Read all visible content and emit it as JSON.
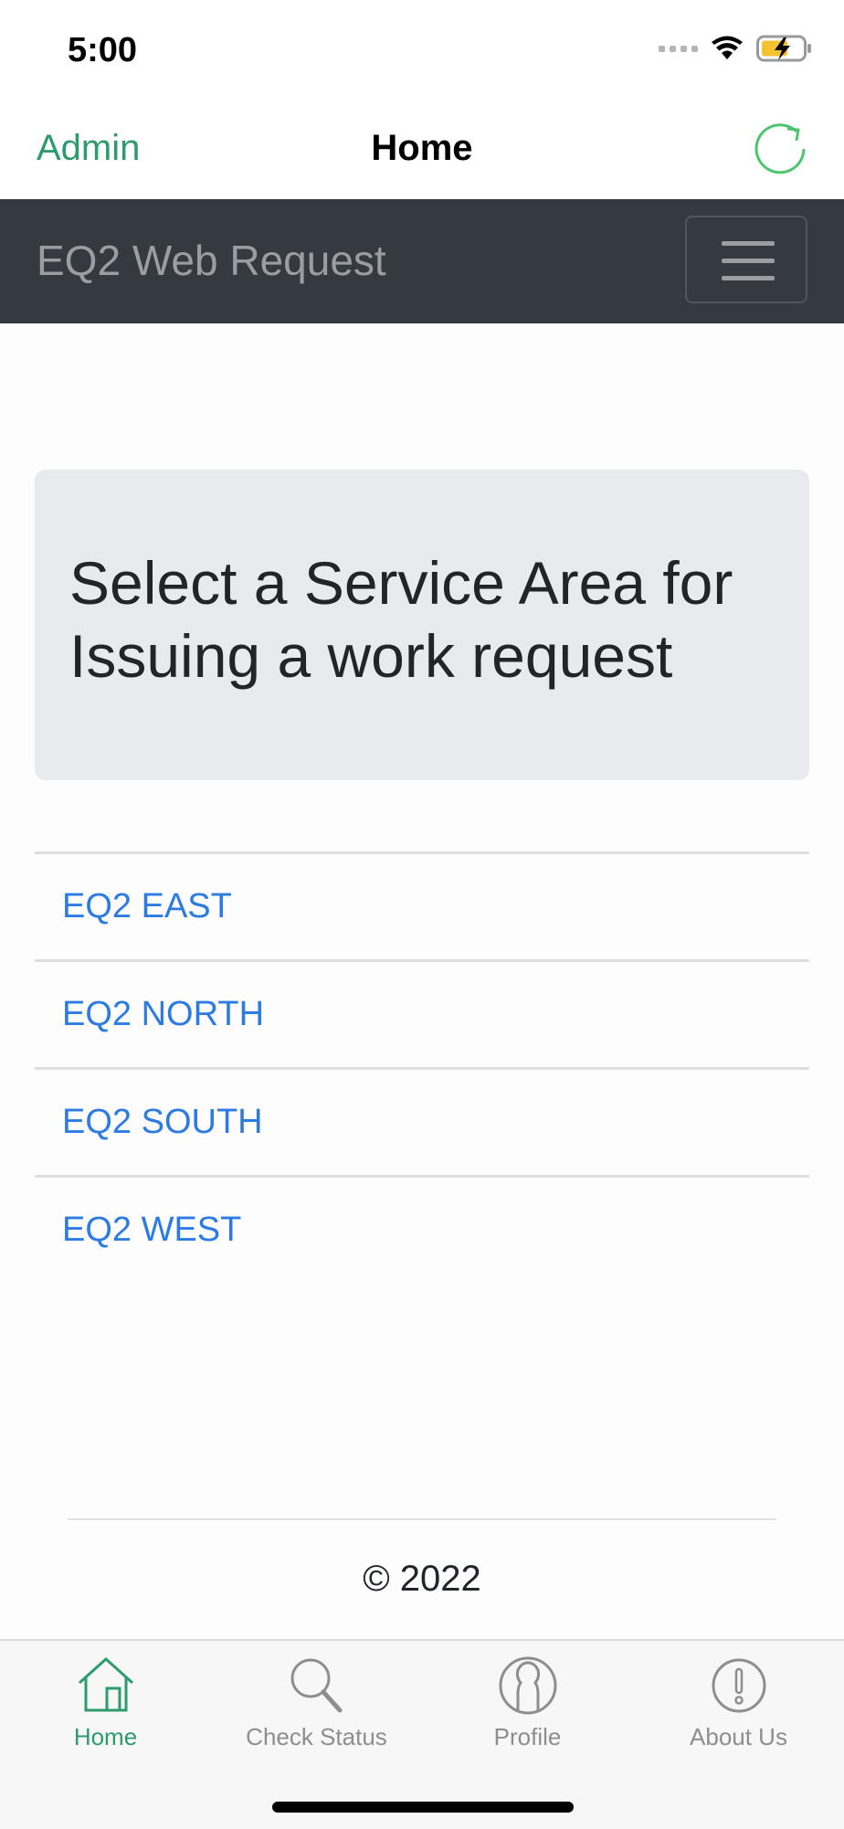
{
  "status_bar": {
    "time": "5:00"
  },
  "nav": {
    "left_label": "Admin",
    "title": "Home"
  },
  "web_navbar": {
    "brand": "EQ2 Web Request"
  },
  "jumbotron": {
    "heading": "Select a Service Area for Issuing a work request"
  },
  "service_areas": [
    "EQ2 EAST",
    "EQ2 NORTH",
    "EQ2 SOUTH",
    "EQ2 WEST"
  ],
  "footer": {
    "text": "© 2022"
  },
  "tabs": [
    {
      "label": "Home",
      "icon": "home-icon",
      "active": true
    },
    {
      "label": "Check Status",
      "icon": "search-icon",
      "active": false
    },
    {
      "label": "Profile",
      "icon": "profile-icon",
      "active": false
    },
    {
      "label": "About Us",
      "icon": "info-icon",
      "active": false
    }
  ],
  "colors": {
    "accent": "#2e9b6d",
    "link": "#2c7be5",
    "navbar_dark": "#343a40",
    "jumbotron": "#e9eaed"
  }
}
